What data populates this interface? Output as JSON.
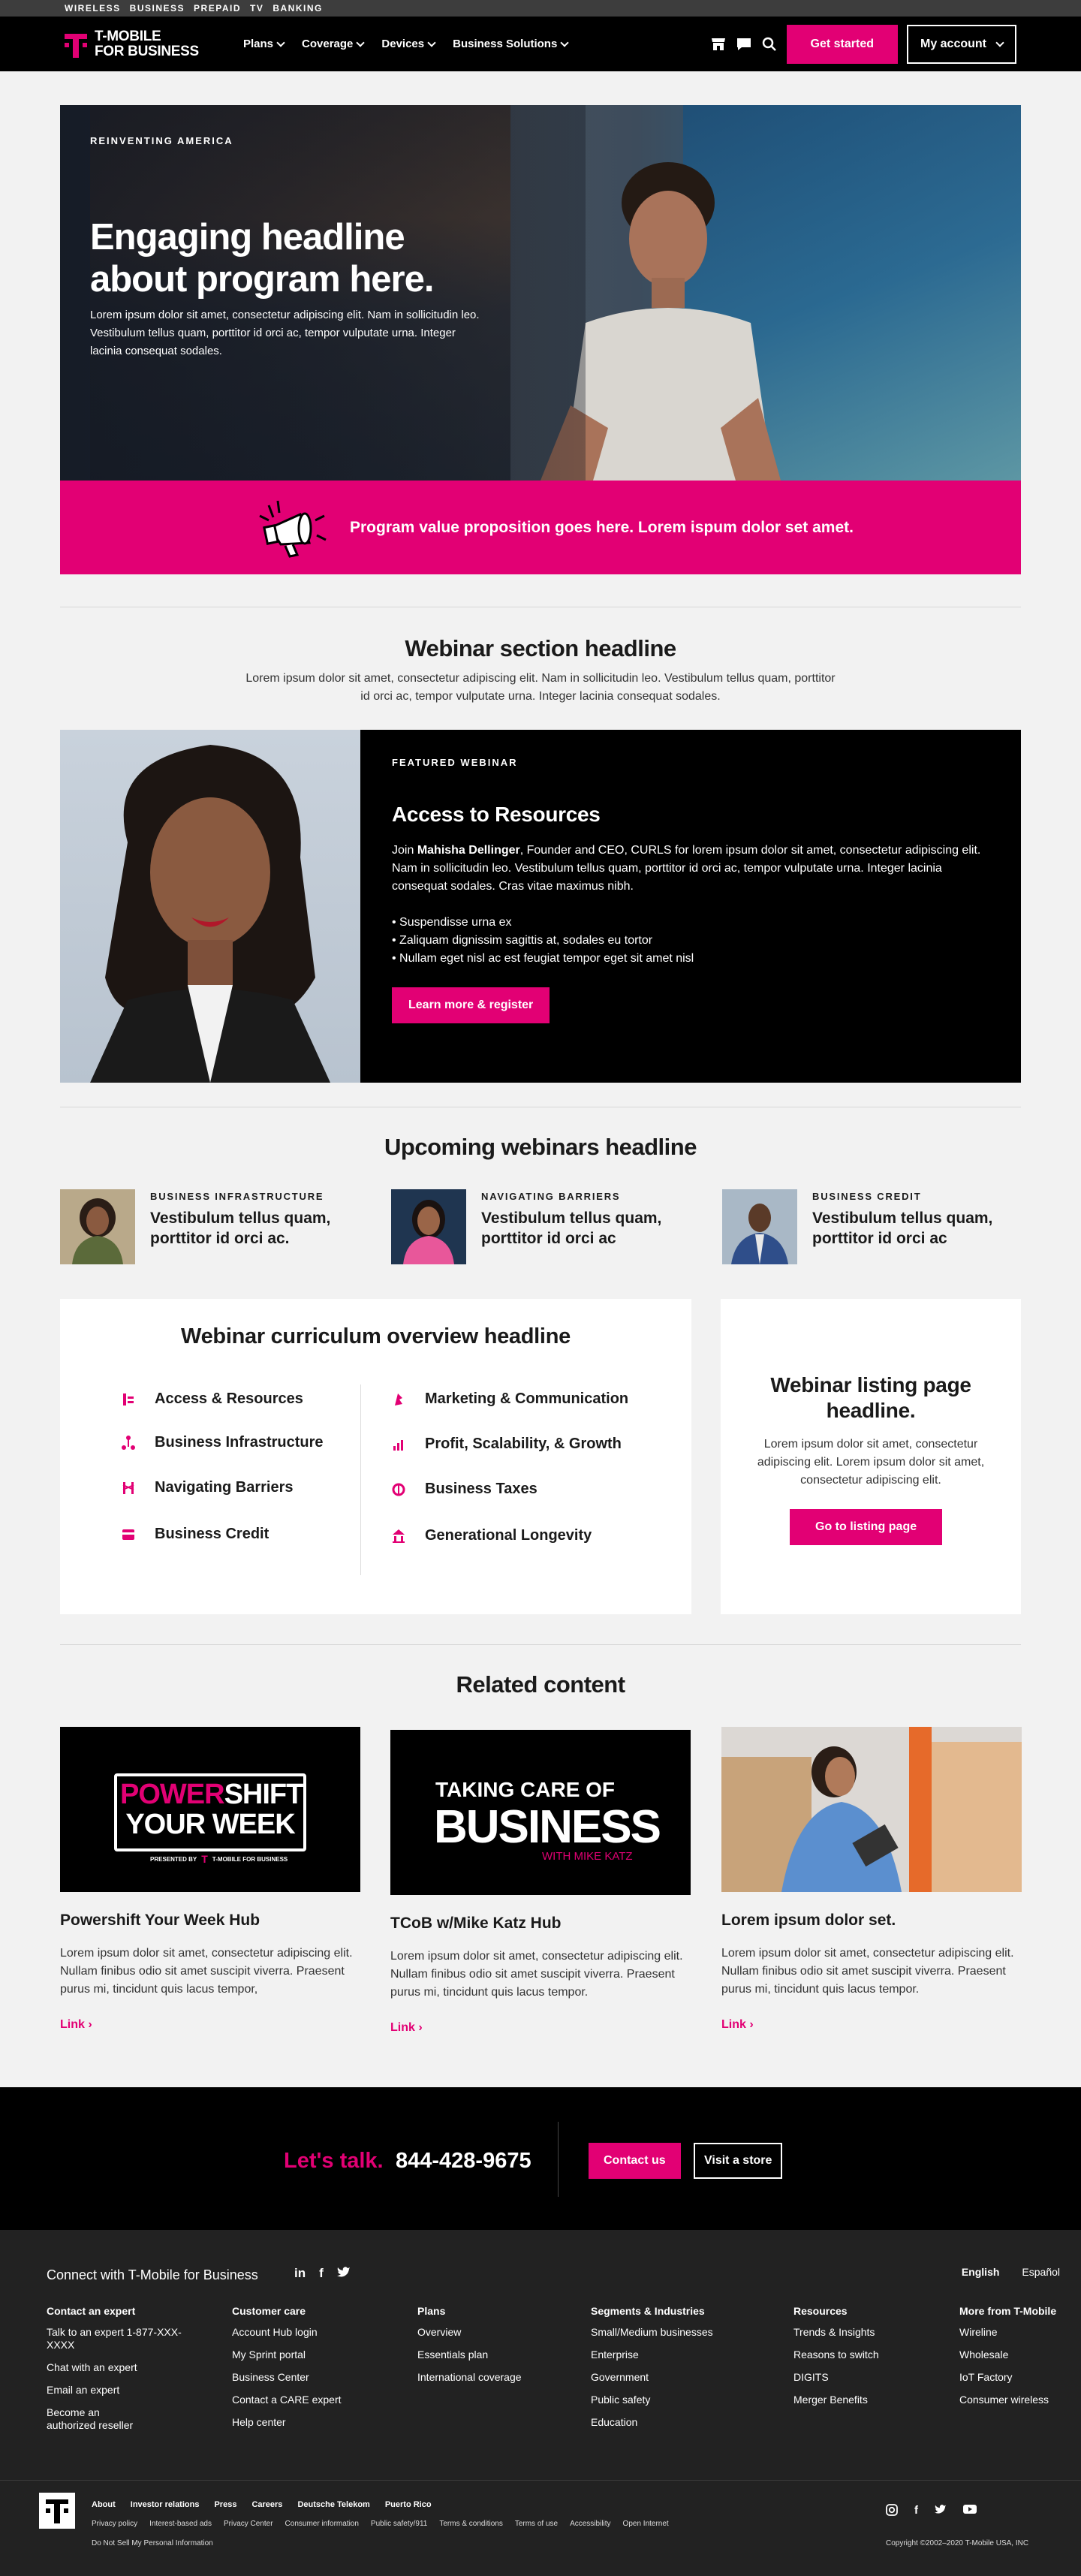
{
  "utility": [
    "WIRELESS",
    "BUSINESS",
    "PREPAID",
    "TV",
    "BANKING"
  ],
  "nav": {
    "brand_line1": "T-MOBILE",
    "brand_line2": "FOR BUSINESS",
    "menu": [
      "Plans",
      "Coverage",
      "Devices",
      "Business Solutions"
    ],
    "cta": "Get started",
    "account": "My account"
  },
  "hero": {
    "eyebrow": "REINVENTING AMERICA",
    "headline": "Engaging headline about program here.",
    "body": "Lorem ipsum dolor sit amet, consectetur adipiscing elit. Nam in sollicitudin leo. Vestibulum tellus quam, porttitor id orci ac, tempor vulputate urna. Integer lacinia consequat sodales.",
    "band": "Program value proposition goes here. Lorem ispum dolor set amet."
  },
  "webinar": {
    "headline": "Webinar section headline",
    "body": "Lorem ipsum dolor sit amet, consectetur adipiscing elit. Nam in sollicitudin leo. Vestibulum tellus quam, porttitor id orci ac, tempor vulputate urna. Integer lacinia consequat sodales.",
    "featured_label": "FEATURED WEBINAR",
    "featured_title": "Access to Resources",
    "join": "Join",
    "presenter": "Mahisha Dellinger",
    "featured_body": ", Founder and CEO, CURLS for lorem ipsum dolor sit amet, consectetur adipiscing elit. Nam in sollicitudin leo. Vestibulum tellus quam, porttitor id orci ac, tempor vulputate urna. Integer lacinia consequat sodales. Cras vitae maximus nibh.",
    "bullets": [
      "• Suspendisse urna ex",
      "• Zaliquam dignissim sagittis at, sodales eu tortor",
      "• Nullam eget nisl ac est feugiat tempor eget sit amet nisl"
    ],
    "cta": "Learn more & register"
  },
  "upcoming": {
    "headline": "Upcoming webinars headline",
    "items": [
      {
        "category": "BUSINESS INFRASTRUCTURE",
        "title": "Vestibulum tellus quam, porttitor id orci ac."
      },
      {
        "category": "NAVIGATING BARRIERS",
        "title": "Vestibulum tellus quam, porttitor id orci ac"
      },
      {
        "category": "BUSINESS CREDIT",
        "title": "Vestibulum tellus quam, porttitor id orci ac"
      }
    ]
  },
  "curriculum": {
    "headline": "Webinar curriculum overview headline",
    "left": [
      "Access & Resources",
      "Business Infrastructure",
      "Navigating Barriers",
      "Business Credit"
    ],
    "right": [
      "Marketing & Communication",
      "Profit, Scalability, & Growth",
      "Business Taxes",
      "Generational Longevity"
    ]
  },
  "listing": {
    "headline": "Webinar listing page headline.",
    "body": "Lorem ipsum dolor sit amet, consectetur adipiscing elit. Lorem ipsum dolor sit amet, consectetur adipiscing elit.",
    "cta": "Go to listing page"
  },
  "related": {
    "headline": "Related content",
    "items": [
      {
        "title": "Powershift Your Week Hub",
        "body": "Lorem ipsum dolor sit amet, consectetur adipiscing elit. Nullam finibus odio sit amet suscipit viverra. Praesent purus mi, tincidunt quis lacus tempor,",
        "link": "Link"
      },
      {
        "title": "TCoB w/Mike Katz Hub",
        "body": "Lorem ipsum dolor sit amet, consectetur adipiscing elit. Nullam finibus odio sit amet suscipit viverra. Praesent purus mi, tincidunt quis lacus tempor.",
        "link": "Link"
      },
      {
        "title": "Lorem ipsum dolor set.",
        "body": "Lorem ipsum dolor sit amet, consectetur adipiscing elit. Nullam finibus odio sit amet suscipit viverra. Praesent purus mi, tincidunt quis lacus tempor.",
        "link": "Link"
      }
    ],
    "powershift": {
      "l1a": "POWER",
      "l1b": "SHIFT",
      "l2": "YOUR WEEK",
      "presented": "PRESENTED BY",
      "brand": "T-MOBILE FOR BUSINESS"
    },
    "tcob": {
      "l1": "TAKING CARE OF",
      "l2": "BUSINESS",
      "l3": "WITH MIKE KATZ"
    }
  },
  "talk": {
    "label": "Let's talk.",
    "phone": "844-428-9675",
    "contact": "Contact us",
    "store": "Visit a store"
  },
  "footer": {
    "connect": "Connect with T-Mobile for Business",
    "languages": [
      "English",
      "Español"
    ],
    "columns": [
      {
        "heading": "Contact an expert",
        "links": [
          "Talk to an expert 1-877-XXX-XXXX",
          "Chat with an expert",
          "Email an expert",
          "Become an authorized reseller"
        ]
      },
      {
        "heading": "Customer care",
        "links": [
          "Account Hub login",
          "My Sprint portal",
          "Business Center",
          "Contact a CARE expert",
          "Help center"
        ]
      },
      {
        "heading": "Plans",
        "links": [
          "Overview",
          "Essentials plan",
          "International coverage"
        ]
      },
      {
        "heading": "Segments & Industries",
        "links": [
          "Small/Medium businesses",
          "Enterprise",
          "Government",
          "Public safety",
          "Education"
        ]
      },
      {
        "heading": "Resources",
        "links": [
          "Trends & Insights",
          "Reasons to switch",
          "DIGITS",
          "Merger Benefits"
        ]
      },
      {
        "heading": "More from T-Mobile",
        "links": [
          "Wireline",
          "Wholesale",
          "IoT Factory",
          "Consumer wireless"
        ]
      }
    ],
    "legal1": [
      "About",
      "Investor relations",
      "Press",
      "Careers",
      "Deutsche Telekom",
      "Puerto Rico"
    ],
    "legal2": [
      "Privacy policy",
      "Interest-based ads",
      "Privacy Center",
      "Consumer information",
      "Public safety/911",
      "Terms & conditions",
      "Terms of use",
      "Accessibility",
      "Open Internet"
    ],
    "legal3": "Do Not Sell My Personal Information",
    "copyright": "Copyright ©2002–2020 T-Mobile USA, INC"
  }
}
